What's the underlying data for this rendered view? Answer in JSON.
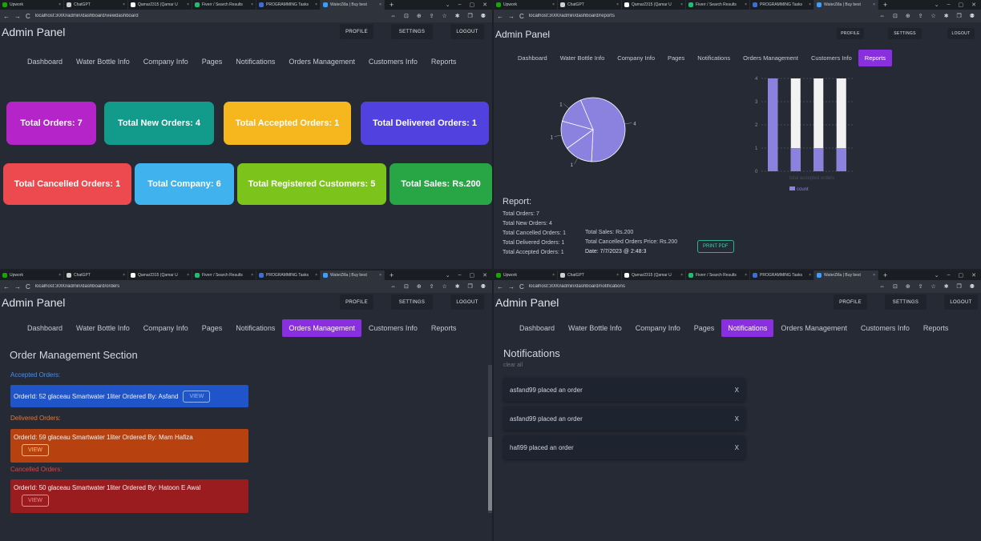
{
  "browser": {
    "tabs": [
      {
        "label": "Upwork",
        "color": "#14a800"
      },
      {
        "label": "ChatGPT",
        "color": "#d0d0d0"
      },
      {
        "label": "Qamar2315 (Qamar U",
        "color": "#ffffff"
      },
      {
        "label": "Fiverr / Search Results",
        "color": "#1dbf73"
      },
      {
        "label": "PROGRAMMING Tasks",
        "color": "#3b6fd8"
      },
      {
        "label": "WaterZilla | Buy best",
        "color": "#3aa0ff"
      }
    ],
    "new_tab": "+",
    "window_controls": [
      "⌄",
      "–",
      "▢",
      "✕"
    ],
    "nav": [
      "←",
      "→",
      "C"
    ],
    "tools": "⇔ ⊡ ⊕ ⇪ ☆ ✱ ❐ ⚉"
  },
  "app": {
    "title": "Admin Panel",
    "buttons": {
      "profile": "PROFILE",
      "settings": "SETTINGS",
      "logout": "LOGOUT"
    },
    "nav": [
      "Dashboard",
      "Water Bottle Info",
      "Company Info",
      "Pages",
      "Notifications",
      "Orders Management",
      "Customers Info",
      "Reports"
    ]
  },
  "dashboard": {
    "url": "localhost:3000/admin/dashboard/viewdashboard",
    "cards": [
      {
        "label": "Total Orders: 7",
        "color": "#b524c9"
      },
      {
        "label": "Total New Orders: 4",
        "color": "#129a8a"
      },
      {
        "label": "Total Accepted Orders: 1",
        "color": "#f5b71d"
      },
      {
        "label": "Total Delivered Orders: 1",
        "color": "#5142e0"
      },
      {
        "label": "Total Cancelled Orders: 1",
        "color": "#ec4a4e"
      },
      {
        "label": "Total Company: 6",
        "color": "#40b2ee"
      },
      {
        "label": "Total Registered Customers: 5",
        "color": "#7cc31c"
      },
      {
        "label": "Total Sales: Rs.200",
        "color": "#28a545"
      }
    ]
  },
  "reports": {
    "url": "localhost:3000/admin/dashboard/reports",
    "active_nav": "Reports",
    "report_title": "Report:",
    "lines_left": [
      "Total Orders: 7",
      "Total New Orders: 4",
      "Total Cancelled Orders: 1",
      "Total Delivered Orders: 1",
      "Total Accepted Orders: 1"
    ],
    "lines_right": [
      "Total Sales: Rs.200",
      "Total Cancelled Orders Price: Rs.200",
      "Date: 7/7/2023 @ 2:48:3"
    ],
    "print_button": "PRINT PDF",
    "pie_labels": [
      "4",
      "1",
      "1",
      "1"
    ],
    "bar_legend": "count",
    "bar_caption": "total accepted orders"
  },
  "chart_data": [
    {
      "type": "pie",
      "labels": [
        "4",
        "1",
        "1",
        "1"
      ],
      "values": [
        4,
        1,
        1,
        1
      ],
      "color": "#8b82e0"
    },
    {
      "type": "bar",
      "categories": [
        "",
        "",
        "",
        ""
      ],
      "series": [
        {
          "name": "count",
          "values": [
            4,
            1,
            1,
            1
          ]
        }
      ],
      "ylim": [
        0,
        4
      ],
      "yticks": [
        "0",
        "1",
        "2",
        "3",
        "4"
      ],
      "xlabel": "total accepted orders",
      "grid": true
    }
  ],
  "orders": {
    "url": "localhost:3000/admin/dashboard/orders",
    "active_nav": "Orders Management",
    "section_title": "Order Management Section",
    "groups": [
      {
        "label": "Accepted Orders:",
        "label_color": "#4a8ef0",
        "box_color": "#1f55c8",
        "text": "OrderId: 52 glaceau Smartwater 1liter Ordered By: Asfand",
        "button": "VIEW",
        "btn_color": "#8fb8ff"
      },
      {
        "label": "Delivered Orders:",
        "label_color": "#e07a3c",
        "box_color": "#b8420f",
        "text": "OrderId: 59 glaceau Smartwater 1liter Ordered By: Mam Hafiza",
        "button": "VIEW",
        "btn_color": "#f5c36a"
      },
      {
        "label": "Cancelled Orders:",
        "label_color": "#d94848",
        "box_color": "#9b1c1f",
        "text": "OrderId: 50 glaceau Smartwater 1liter Ordered By: Hatoon E Awal",
        "button": "VIEW",
        "btn_color": "#f08a8a"
      }
    ]
  },
  "notifications": {
    "url": "localhost:3000/admin/dashboard/notifications",
    "active_nav": "Notifications",
    "title": "Notifications",
    "clear": "clear all",
    "items": [
      "asfand99 placed an order",
      "asfand99 placed an order",
      "hafi99 placed an order"
    ],
    "dismiss": "X"
  }
}
